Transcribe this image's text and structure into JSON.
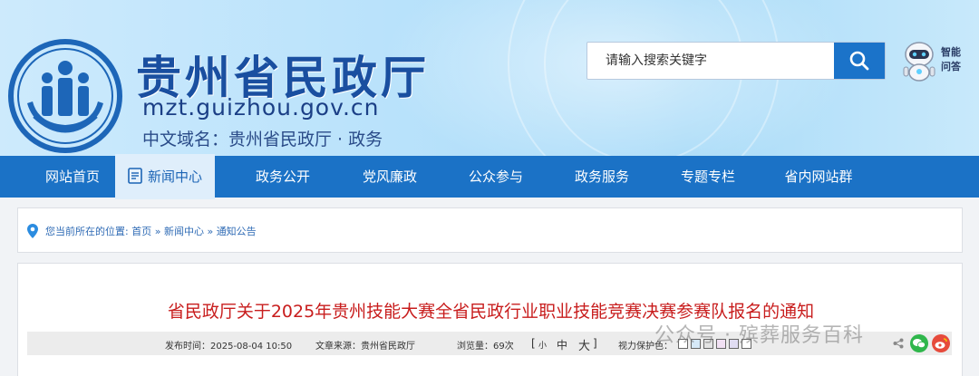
{
  "header": {
    "site_title": "贵州省民政厅",
    "domain": "mzt.guizhou.gov.cn",
    "cn_domain": "中文域名：贵州省民政厅 · 政务",
    "search_placeholder": "请输入搜索关键字",
    "assistant_label_line1": "智能",
    "assistant_label_line2": "问答"
  },
  "nav": {
    "items": [
      {
        "label": "网站首页"
      },
      {
        "label": "新闻中心",
        "active": true
      },
      {
        "label": "政务公开"
      },
      {
        "label": "党风廉政"
      },
      {
        "label": "公众参与"
      },
      {
        "label": "政务服务"
      },
      {
        "label": "专题专栏"
      },
      {
        "label": "省内网站群"
      }
    ]
  },
  "breadcrumb": {
    "prefix": "您当前所在的位置:",
    "items": [
      "首页",
      "新闻中心",
      "通知公告"
    ],
    "separator": "»"
  },
  "article": {
    "title": "省民政厅关于2025年贵州技能大赛全省民政行业职业技能竞赛决赛参赛队报名的通知",
    "published": "发布时间：2025-08-04 10:50",
    "source": "文章来源：贵州省民政厅",
    "views": "浏览量：69次",
    "font_size_options": [
      "小",
      "中",
      "大"
    ],
    "bracket_open": "[",
    "bracket_close": "]",
    "vision_protection": "视力保护色：",
    "protection_colors": [
      "#ffffff",
      "#d6e9f8",
      "#e3e3e3",
      "#f2e1f4",
      "#e1ddf3",
      "#ffffff"
    ]
  },
  "watermark": "公众号 · 殡葬服务百科",
  "colors": {
    "nav_bg": "#1b72c6",
    "title_red": "#c81d1d",
    "brand_blue": "#1a4fa0"
  }
}
